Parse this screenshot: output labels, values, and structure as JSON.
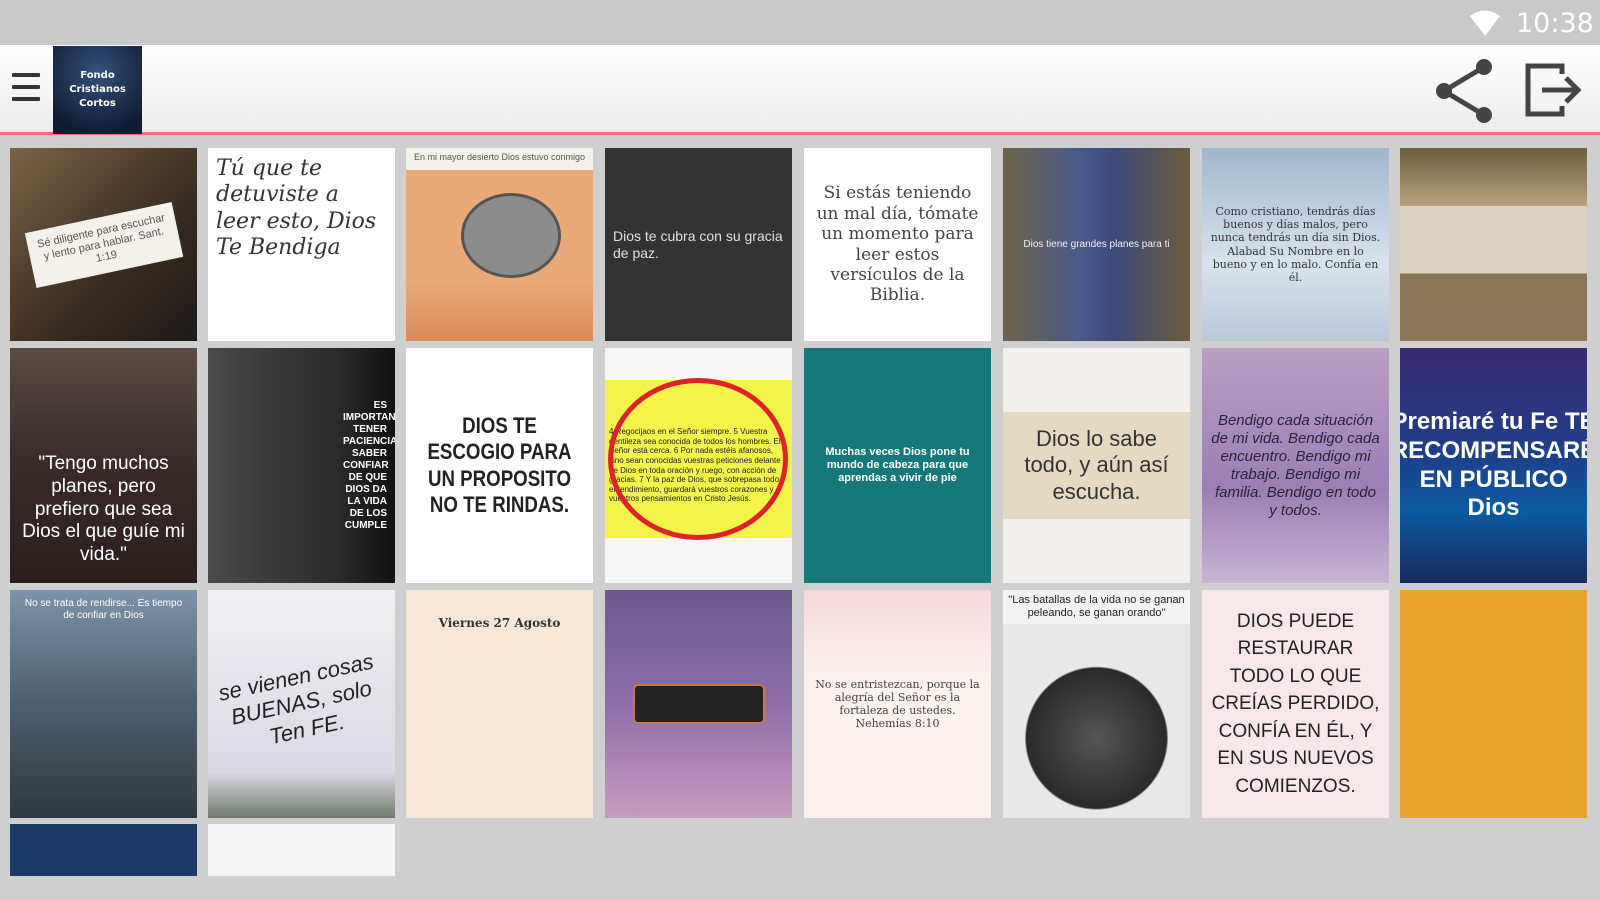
{
  "status_bar": {
    "time": "10:38",
    "wifi_icon": "wifi-icon"
  },
  "app_bar": {
    "menu_icon": "hamburger-menu-icon",
    "logo_text": "Fondo Cristianos Cortos",
    "share_icon": "share-icon",
    "exit_icon": "exit-icon",
    "accent_color": "#e8747a"
  },
  "tiles": [
    {
      "text": "Sé diligente para escuchar y lento para hablar. Sant. 1:19"
    },
    {
      "text": "Tú que te detuviste a leer esto, Dios Te Bendiga"
    },
    {
      "text": "En mi mayor desierto Dios estuvo conmigo"
    },
    {
      "text": "Dios te cubra con su gracia de paz."
    },
    {
      "text": "Si estás teniendo un mal día, tómate un momento para leer estos versículos de la Biblia."
    },
    {
      "text": "Dios tiene grandes planes para ti"
    },
    {
      "text": "Como cristiano, tendrás días buenos y días malos, pero nunca tendrás un día sin Dios. Alabad Su Nombre en lo bueno y en lo malo. Confía en él."
    },
    {
      "text": ""
    },
    {
      "text": "\"Tengo muchos planes, pero prefiero que sea Dios el que guíe mi vida.\""
    },
    {
      "text": "ES IMPORTANTE TENER PACIENCIA SABER CONFIAR DE QUE DIOS DA LA VIDA DE LOS CUMPLE"
    },
    {
      "text": "DIOS TE ESCOGIO PARA UN PROPOSITO NO TE RINDAS."
    },
    {
      "text": "4 Regocijaos en el Señor siempre. 5 Vuestra gentileza sea conocida de todos los hombres. El Señor está cerca. 6 Por nada estéis afanosos, sino sean conocidas vuestras peticiones delante de Dios en toda oración y ruego, con acción de gracias. 7 Y la paz de Dios, que sobrepasa todo entendimiento, guardará vuestros corazones y vuestros pensamientos en Cristo Jesús."
    },
    {
      "text": "Muchas veces Dios pone tu mundo de cabeza para que aprendas a vivir de pie"
    },
    {
      "text": "Dios lo sabe todo, y aún así escucha."
    },
    {
      "text": "Bendigo cada situación de mi vida. Bendigo cada encuentro. Bendigo mi trabajo. Bendigo mi familia. Bendigo en todo y todos."
    },
    {
      "text": "Premiaré tu Fe TE RECOMPENSARÉ EN PÚBLICO Dios"
    },
    {
      "text": "No se trata de rendirse... Es tiempo de confiar en Dios"
    },
    {
      "text": "se vienen cosas BUENAS, solo Ten FE."
    },
    {
      "text": "Viernes 27 Agosto"
    },
    {
      "text": ""
    },
    {
      "text": "No se entristezcan, porque la alegría del Señor es la fortaleza de ustedes. Nehemías 8:10"
    },
    {
      "text": "\"Las batallas de la vida no se ganan peleando, se ganan orando\""
    },
    {
      "text": "DIOS PUEDE RESTAURAR TODO LO QUE CREÍAS PERDIDO, CONFÍA EN ÉL, Y EN SUS NUEVOS COMIENZOS."
    },
    {
      "text": ""
    },
    {
      "text": ""
    },
    {
      "text": ""
    }
  ]
}
